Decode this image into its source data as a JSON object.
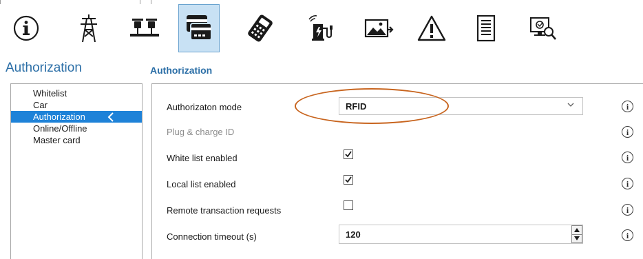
{
  "toolbar": {
    "icons": [
      "info-icon",
      "power-pylon-icon",
      "scale-icon",
      "card-reader-icon",
      "payment-terminal-icon",
      "charging-station-icon",
      "image-export-icon",
      "warning-icon",
      "document-icon",
      "remote-monitor-icon"
    ],
    "active_index": 3
  },
  "sidebar": {
    "title": "Authorization",
    "items": [
      {
        "label": "Whitelist"
      },
      {
        "label": "Car"
      },
      {
        "label": "Authorization"
      },
      {
        "label": "Online/Offline"
      },
      {
        "label": "Master card"
      }
    ],
    "active_index": 2
  },
  "main": {
    "title": "Authorization",
    "fields": {
      "auth_mode": {
        "label": "Authorizaton mode",
        "value": "RFID"
      },
      "plug_charge": {
        "label": "Plug & charge ID"
      },
      "white_list": {
        "label": "White list enabled",
        "checked": true
      },
      "local_list": {
        "label": "Local list enabled",
        "checked": true
      },
      "remote_tx": {
        "label": "Remote transaction requests",
        "checked": false
      },
      "timeout": {
        "label": "Connection timeout (s)",
        "value": "120"
      }
    },
    "info_glyph": "i"
  },
  "colors": {
    "accent_blue": "#2c6fa7",
    "selection_blue": "#1e82d8",
    "active_tile": "#c8e1f4",
    "highlight_ring": "#c8651f"
  }
}
